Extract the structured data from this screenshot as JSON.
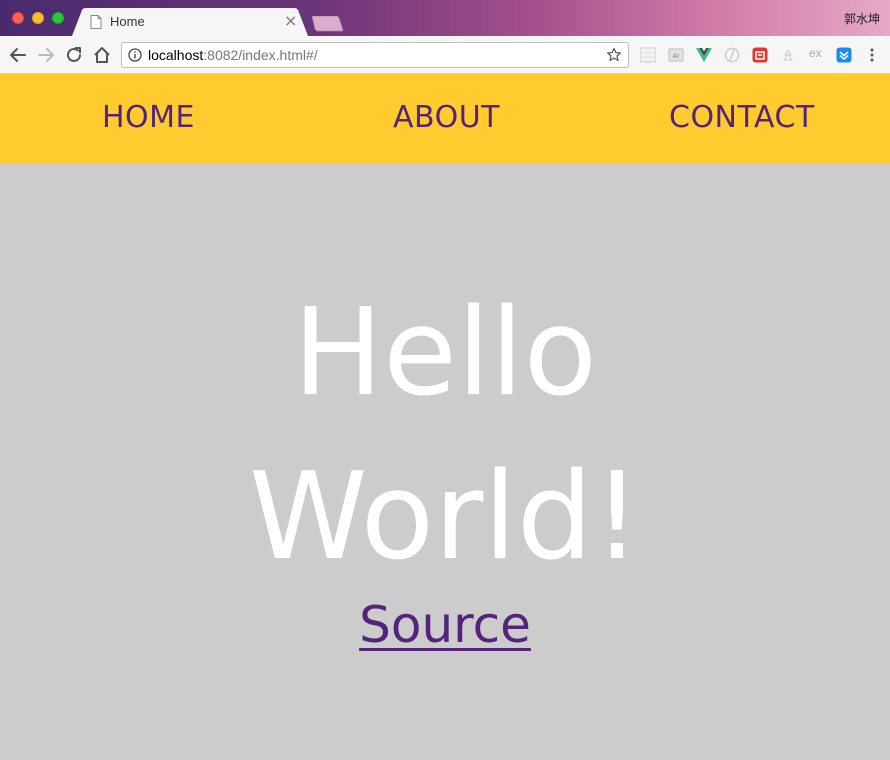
{
  "browser": {
    "tab": {
      "title": "Home",
      "close": "×"
    },
    "profile_name": "郭水坤",
    "url": {
      "host": "localhost",
      "rest": ":8082/index.html#/"
    },
    "extensions": [
      "grid-ext-icon",
      "ar-ext-icon",
      "vue-devtools-icon",
      "ghost-ext-icon",
      "red-ext-icon",
      "tree-ext-icon",
      "ex-ext-icon",
      "blue-ext-icon",
      "menu-icon"
    ],
    "ext_label": "ex"
  },
  "nav": {
    "home": "HOME",
    "about": "ABOUT",
    "contact": "CONTACT"
  },
  "hero": {
    "line1": "Hello",
    "line2": "World!"
  },
  "source_link": "Source",
  "colors": {
    "nav_bg": "#ffcb2f",
    "nav_text": "#532479",
    "page_bg": "#cccccc",
    "hero_text": "#ffffff"
  }
}
